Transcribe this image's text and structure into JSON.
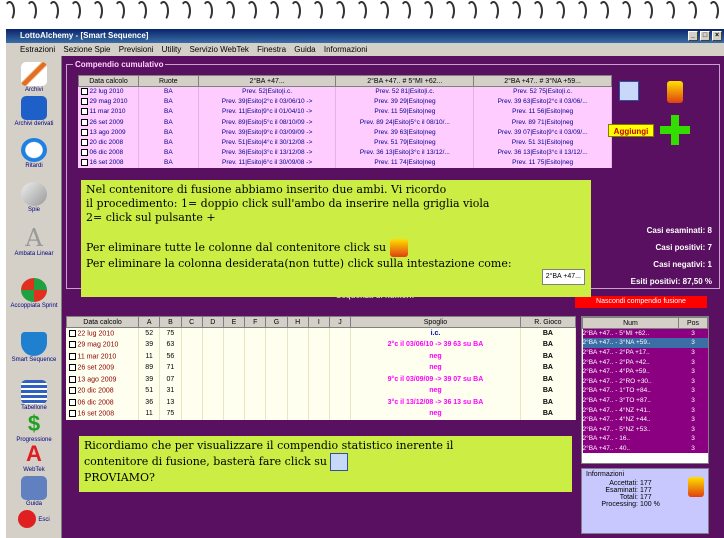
{
  "window": {
    "title": "LottoAlchemy - [Smart Sequence]",
    "controls": [
      "_",
      "□",
      "×"
    ]
  },
  "menu": [
    "Estrazioni",
    "Sezione Spie",
    "Previsioni",
    "Utility",
    "Servizio WebTek",
    "Finestra",
    "Guida",
    "Informazioni"
  ],
  "sidebar": {
    "items": [
      {
        "label": "Archivi",
        "icon": "pencil-icon"
      },
      {
        "label": "Archivi derivati",
        "icon": "book-icon"
      },
      {
        "label": "Ritardi",
        "icon": "clock-icon"
      },
      {
        "label": "Spie",
        "icon": "flashlight-icon"
      },
      {
        "label": "Ambata Linear",
        "icon": "letter-a-icon"
      },
      {
        "label": "Accoppiata Sprint",
        "icon": "arrows-icon"
      },
      {
        "label": "Smart Sequence",
        "icon": "shield-icon"
      },
      {
        "label": "Tabellone",
        "icon": "table-icon"
      },
      {
        "label": "Progressione",
        "icon": "dollar-icon"
      },
      {
        "label": "WebTek",
        "icon": "webtek-icon"
      },
      {
        "label": "Guida",
        "icon": "help-book-icon"
      },
      {
        "label": "Esci",
        "icon": "exit-icon"
      }
    ]
  },
  "compendio": {
    "title": "Compendio cumulativo",
    "headers": [
      "Data calcolo",
      "Ruote",
      "2°BA +47...",
      "2°BA +47.. # 5°MI +62...",
      "2°BA +47.. # 3°NA +59..."
    ],
    "rows": [
      [
        "22 lug 2010",
        "BA",
        "Prev. 52|Esito|i.c.",
        "Prev. 52 81|Esito|i.c.",
        "Prev. 52 75|Esito|i.c."
      ],
      [
        "29 mag 2010",
        "BA",
        "Prev. 39|Esito|2°c il 03/06/10 ->",
        "Prev. 39 29|Esito|neg",
        "Prev. 39 63|Esito|2°c il 03/06/..."
      ],
      [
        "11 mar 2010",
        "BA",
        "Prev. 11|Esito|9°c il 01/04/10 ->",
        "Prev. 11 59|Esito|neg",
        "Prev. 11 56|Esito|neg"
      ],
      [
        "26 set 2009",
        "BA",
        "Prev. 89|Esito|5°c il 08/10/09 ->",
        "Prev. 89 24|Esito|5°c il 08/10/...",
        "Prev. 89 71|Esito|neg"
      ],
      [
        "13 ago 2009",
        "BA",
        "Prev. 39|Esito|9°c il 03/09/09 ->",
        "Prev. 39 63|Esito|neg",
        "Prev. 39 07|Esito|9°c il 03/09/..."
      ],
      [
        "20 dic 2008",
        "BA",
        "Prev. 51|Esito|4°c il 30/12/08 ->",
        "Prev. 51 79|Esito|neg",
        "Prev. 51 31|Esito|neg"
      ],
      [
        "06 dic 2008",
        "BA",
        "Prev. 36|Esito|3°c il 13/12/08 ->",
        "Prev. 36 13|Esito|3°c il 13/12/...",
        "Prev. 36 13|Esito|3°c il 13/12/..."
      ],
      [
        "16 set 2008",
        "BA",
        "Prev. 11|Esito|6°c il 30/09/08 ->",
        "Prev. 11 74|Esito|neg",
        "Prev. 11 75|Esito|neg"
      ]
    ],
    "add_button": "Aggiungi",
    "stats": [
      {
        "label": "Casi esaminati:",
        "value": "8"
      },
      {
        "label": "Casi positivi:",
        "value": "7"
      },
      {
        "label": "Casi negativi:",
        "value": "1"
      },
      {
        "label": "Esiti positivi:",
        "value": "87,50 %"
      }
    ],
    "sequence_label": "Sequenza di numeri:",
    "hide_button": "Nascondi compendio fusione",
    "tooltip_tag": "2°BA +47..."
  },
  "bottom_grid": {
    "headers": [
      "Data calcolo",
      "A",
      "B",
      "C",
      "D",
      "E",
      "F",
      "G",
      "H",
      "I",
      "J",
      "Spoglio",
      "R. Gioco"
    ],
    "rows": [
      {
        "date": "22 lug 2010",
        "a": "52",
        "b": "75",
        "spoglio": "i.c.",
        "ruota": "BA"
      },
      {
        "date": "29 mag 2010",
        "a": "39",
        "b": "63",
        "spoglio": "2°c il 03/06/10 -> 39 63 su BA",
        "ruota": "BA"
      },
      {
        "date": "11 mar 2010",
        "a": "11",
        "b": "56",
        "spoglio": "neg",
        "ruota": "BA"
      },
      {
        "date": "26 set 2009",
        "a": "89",
        "b": "71",
        "spoglio": "neg",
        "ruota": "BA"
      },
      {
        "date": "13 ago 2009",
        "a": "39",
        "b": "07",
        "spoglio": "9°c il 03/09/09 -> 39 07 su BA",
        "ruota": "BA"
      },
      {
        "date": "20 dic 2008",
        "a": "51",
        "b": "31",
        "spoglio": "neg",
        "ruota": "BA"
      },
      {
        "date": "06 dic 2008",
        "a": "36",
        "b": "13",
        "spoglio": "3°c il 13/12/08 -> 36 13 su BA",
        "ruota": "BA"
      },
      {
        "date": "16 set 2008",
        "a": "11",
        "b": "75",
        "spoglio": "neg",
        "ruota": "BA"
      }
    ]
  },
  "right_list": {
    "headers": [
      "Num",
      "Pos"
    ],
    "rows": [
      {
        "num": "2°BA +47.. - 5°MI +62..",
        "pos": "3",
        "selected": false
      },
      {
        "num": "2°BA +47.. - 3°NA +59..",
        "pos": "3",
        "selected": true
      },
      {
        "num": "2°BA +47.. - 2°PA +17..",
        "pos": "3",
        "selected": false
      },
      {
        "num": "2°BA +47.. - 2°PA +42..",
        "pos": "3",
        "selected": false
      },
      {
        "num": "2°BA +47.. - 4°PA +59..",
        "pos": "3",
        "selected": false
      },
      {
        "num": "2°BA +47.. - 2°RO +30..",
        "pos": "3",
        "selected": false
      },
      {
        "num": "2°BA +47.. - 1°TO +84..",
        "pos": "3",
        "selected": false
      },
      {
        "num": "2°BA +47.. - 3°TO +87..",
        "pos": "3",
        "selected": false
      },
      {
        "num": "2°BA +47.. - 4°NZ +41..",
        "pos": "3",
        "selected": false
      },
      {
        "num": "2°BA +47.. - 4°NZ +44..",
        "pos": "3",
        "selected": false
      },
      {
        "num": "2°BA +47.. - 5°NZ +53..",
        "pos": "3",
        "selected": false
      },
      {
        "num": "2°BA +47.. - 16..",
        "pos": "3",
        "selected": false
      },
      {
        "num": "2°BA +47.. - 40..",
        "pos": "3",
        "selected": false
      }
    ]
  },
  "info": {
    "title": "Informazioni",
    "rows": [
      {
        "label": "Accettati:",
        "value": "177"
      },
      {
        "label": "Esaminati:",
        "value": "177"
      },
      {
        "label": "Totali:",
        "value": "177"
      },
      {
        "label": "Processing:",
        "value": "100 %"
      }
    ]
  },
  "notes": {
    "note1": [
      "Nel contenitore di fusione abbiamo inserito due ambi. Vi ricordo",
      " il procedimento: 1= doppio click sull'ambo da inserire nella griglia viola",
      "2= click sul pulsante +",
      "",
      "Per eliminare tutte le colonne dal contenitore click su",
      "Per eliminare la colonna desiderata(non tutte) click sulla intestazione come:"
    ],
    "note2": [
      "Ricordiamo che per visualizzare il compendio statistico inerente il",
      "contenitore di fusione, basterà fare click su",
      "PROVIAMO?"
    ]
  }
}
